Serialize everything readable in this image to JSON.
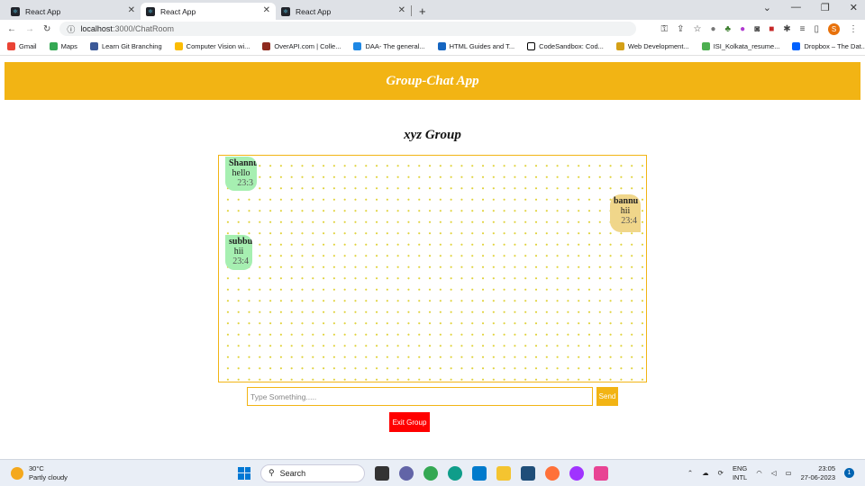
{
  "browser": {
    "tabs": [
      {
        "label": "React App",
        "active": false
      },
      {
        "label": "React App",
        "active": true
      },
      {
        "label": "React App",
        "active": false
      }
    ],
    "url_host": "localhost",
    "url_path": ":3000/ChatRoom",
    "profile_initial": "S",
    "bookmarks": [
      {
        "label": "Gmail",
        "color": "#ea4335"
      },
      {
        "label": "Maps",
        "color": "#34a853"
      },
      {
        "label": "Learn Git Branching",
        "color": "#3b5998"
      },
      {
        "label": "Computer Vision wi...",
        "color": "#fbbc04"
      },
      {
        "label": "OverAPI.com | Colle...",
        "color": "#8e2a1e"
      },
      {
        "label": "DAA- The general...",
        "color": "#1e88e5"
      },
      {
        "label": "HTML Guides and T...",
        "color": "#1565c0"
      },
      {
        "label": "CodeSandbox: Cod...",
        "color": "#000000"
      },
      {
        "label": "Web Development...",
        "color": "#d4a017"
      },
      {
        "label": "ISI_Kolkata_resume...",
        "color": "#4caf50"
      },
      {
        "label": "Dropbox – The Dat...",
        "color": "#0061fe"
      }
    ]
  },
  "app": {
    "title": "Group-Chat App",
    "group_name": "xyz Group",
    "messages": [
      {
        "sender": "Shannu",
        "text": "hello",
        "time": "23:3",
        "side": "left"
      },
      {
        "sender": "bannu",
        "text": "hii",
        "time": "23:4",
        "side": "right"
      },
      {
        "sender": "subbu",
        "text": "hii",
        "time": "23:4",
        "side": "left"
      }
    ],
    "input_placeholder": "Type Something.....",
    "send_label": "Send",
    "exit_label": "Exit Group"
  },
  "taskbar": {
    "temperature": "30°C",
    "weather": "Partly cloudy",
    "search_label": "Search",
    "lang1": "ENG",
    "lang2": "INTL",
    "time": "23:05",
    "date": "27-06-2023",
    "notification_count": "1"
  }
}
